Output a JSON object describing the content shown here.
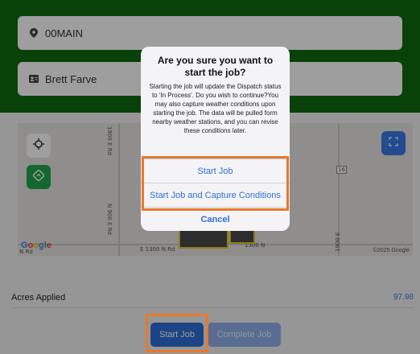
{
  "form": {
    "location": "00MAIN",
    "operator": "Brett Farve"
  },
  "map": {
    "labels": {
      "road_north": "1900 E Rd",
      "road_south": "N 900 E Rd",
      "road_bottom": "E 1300 N Rd",
      "road_bottom2": "1300 N",
      "road_right": "1900 E",
      "marker": "16",
      "nrd": "N Rd"
    },
    "google_logo": "Google",
    "copyright": "©2025 Google"
  },
  "acres": {
    "label": "Acres Applied",
    "value": "97.98"
  },
  "buttons": {
    "start_job": "Start Job",
    "complete_job": "Complete Job"
  },
  "dialog": {
    "title": "Are you sure you want to start the job?",
    "message": "Starting the job will update the Dispatch status to 'In Process'. Do you wish to continue?You may also capture weather conditions upon starting the job. The data will be pulled form nearby weather stations, and you can revise these conditions later.",
    "actions": {
      "start_job": "Start Job",
      "start_capture": "Start Job and Capture Conditions",
      "cancel": "Cancel"
    }
  },
  "colors": {
    "header_green": "#0e6b0e",
    "accent_blue": "#2f6fd6",
    "highlight_orange": "#e6792b"
  },
  "icons": {
    "location": "pin-icon",
    "operator": "id-card-icon",
    "locate": "crosshair-icon",
    "navigate": "navigate-icon",
    "expand": "expand-icon"
  }
}
